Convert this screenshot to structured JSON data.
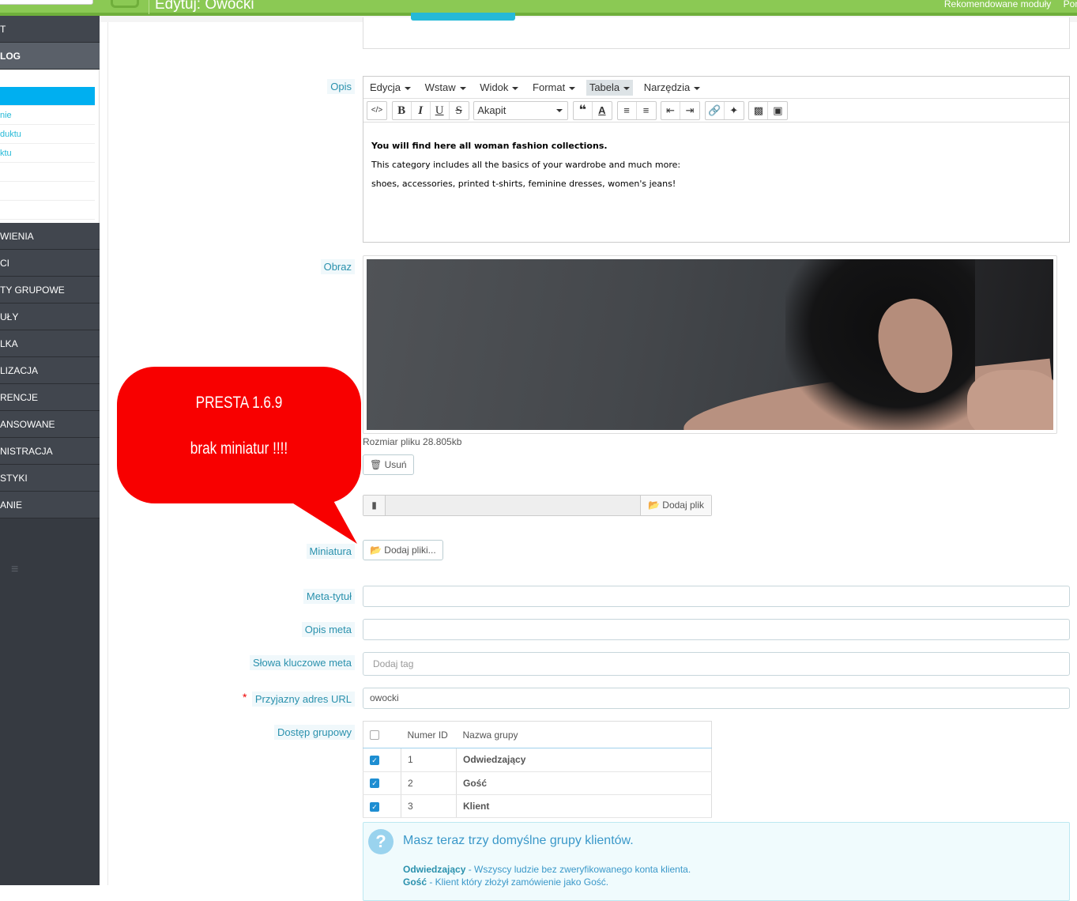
{
  "header": {
    "title": "Edytuj: Owocki",
    "right_links": [
      "Rekomendowane moduły",
      "Pomoc"
    ]
  },
  "sidebar": {
    "items_top": [
      "T",
      "LOG"
    ],
    "submenu": [
      "",
      "nie",
      "duktu",
      "ktu",
      "",
      "",
      ""
    ],
    "items_bottom": [
      "WIENIA",
      "CI",
      "TY GRUPOWE",
      "UŁY",
      "LKA",
      "LIZACJA",
      "RENCJE",
      "ANSOWANE",
      "NISTRACJA",
      "STYKI",
      "ANIE"
    ],
    "collapse_icon": "menu-lines-icon"
  },
  "form": {
    "labels": {
      "opis": "Opis",
      "obraz": "Obraz",
      "miniatura": "Miniatura",
      "meta_tytul": "Meta-tytuł",
      "opis_meta": "Opis meta",
      "slowa_kluczowe": "Słowa kluczowe meta",
      "przyjazny_url": "Przyjazny adres URL",
      "dostep": "Dostęp grupowy"
    },
    "required_marker": "*",
    "editor": {
      "menus": [
        "Edycja",
        "Wstaw",
        "Widok",
        "Format",
        "Tabela",
        "Narzędzia"
      ],
      "active_menu": "Tabela",
      "format_select": "Akapit",
      "content_bold": "You will find here all woman fashion collections.",
      "content_line2": "This category includes all the basics of your wardrobe and much more:",
      "content_line3": "shoes, accessories, printed t-shirts, feminine dresses, women's jeans!"
    },
    "image": {
      "file_size": "Rozmiar pliku 28.805kb",
      "delete_label": "Usuń",
      "add_file_label": "Dodaj plik"
    },
    "thumbnail": {
      "add_files_label": "Dodaj pliki..."
    },
    "meta_title_value": "",
    "meta_desc_value": "",
    "keywords_placeholder": "Dodaj tag",
    "friendly_url_value": "owocki",
    "groups": {
      "col_id": "Numer ID",
      "col_name": "Nazwa grupy",
      "rows": [
        {
          "id": "1",
          "name": "Odwiedzający",
          "checked": true
        },
        {
          "id": "2",
          "name": "Gość",
          "checked": true
        },
        {
          "id": "3",
          "name": "Klient",
          "checked": true
        }
      ]
    },
    "info": {
      "title": "Masz teraz trzy domyślne grupy klientów.",
      "line1_term": "Odwiedzający",
      "line1_text": " - Wszyscy ludzie bez zweryfikowanego konta klienta.",
      "line2_term": "Gość",
      "line2_text": " - Klient który złożył zamówienie jako Gość."
    }
  },
  "annotation": {
    "line1": "PRESTA 1.6.9",
    "line2": "brak miniatur !!!!",
    "color": "#f80000"
  },
  "colors": {
    "header_green": "#8bc954",
    "sidebar_dark": "#363a41",
    "accent_blue": "#25b9d7"
  }
}
